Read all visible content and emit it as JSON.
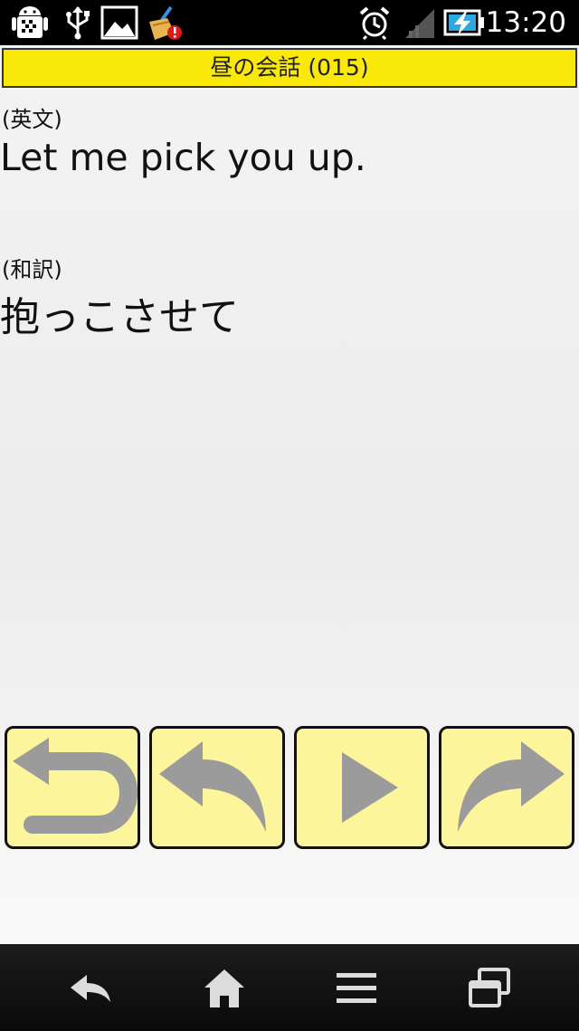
{
  "status_bar": {
    "time": "13:20",
    "icons": [
      "android-debug-icon",
      "usb-icon",
      "image-icon",
      "cleaner-alert-icon",
      "alarm-icon",
      "signal-icon",
      "battery-charging-icon"
    ]
  },
  "header": {
    "title": "昼の会話 (015)"
  },
  "content": {
    "english_label": "(英文)",
    "english_text": "Let me pick you up.",
    "japanese_label": "(和訳)",
    "japanese_text": "抱っこさせて"
  },
  "controls": {
    "buttons": [
      "return-icon",
      "previous-icon",
      "play-icon",
      "next-icon"
    ]
  },
  "colors": {
    "title_bar": "#fae808",
    "button_fill": "#fdf59c",
    "icon_gray": "#9b9b9b"
  },
  "nav_bar": {
    "icons": [
      "back-icon",
      "home-icon",
      "menu-icon",
      "recent-apps-icon"
    ]
  }
}
